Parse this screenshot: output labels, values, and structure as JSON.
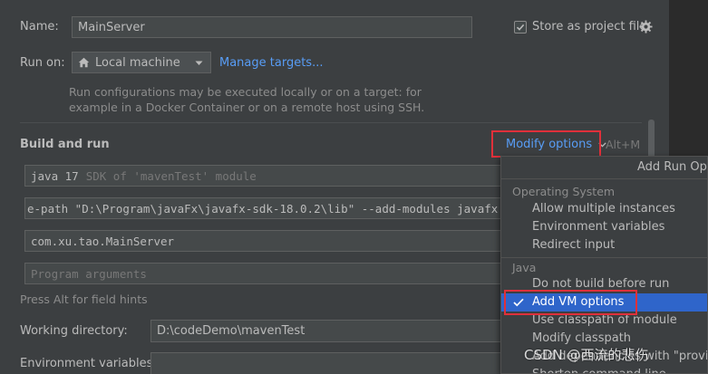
{
  "form": {
    "name_label": "Name:",
    "name_value": "MainServer",
    "store_label": "Store as project file",
    "run_on_label": "Run on:",
    "run_on_value": "Local machine",
    "manage_targets": "Manage targets...",
    "run_on_hint_1": "Run configurations may be executed locally or on a target: for",
    "run_on_hint_2": "example in a Docker Container or on a remote host using SSH.",
    "build_run_heading": "Build and run",
    "modify_options": "Modify options",
    "modify_shortcut": "Alt+M",
    "jdk_value": "java 17",
    "jdk_hint": "SDK of 'mavenTest' module",
    "vm_options_value": "e-path \"D:\\Program\\javaFx\\javafx-sdk-18.0.2\\lib\" --add-modules javafx.contr",
    "main_class_value": "com.xu.tao.MainServer",
    "program_args_placeholder": "Program arguments",
    "field_hints": "Press Alt for field hints",
    "working_dir_label": "Working directory:",
    "working_dir_value": "D:\\codeDemo\\mavenTest",
    "env_vars_label": "Environment variables:"
  },
  "popup": {
    "title": "Add Run Opti",
    "groups": [
      {
        "header": "Operating System",
        "items": [
          "Allow multiple instances",
          "Environment variables",
          "Redirect input"
        ]
      },
      {
        "header": "Java",
        "items": [
          "Do not build before run",
          "Add VM options",
          "Use classpath of module",
          "Modify classpath",
          "Add dependencies with \"provided\"",
          "Shorten command line"
        ]
      }
    ],
    "selected_item": "Add VM options"
  },
  "watermark": "CSDN @西流的悲伤",
  "colors": {
    "background": "#3c3f41",
    "accent_link": "#589df6",
    "selection": "#2f65ca",
    "highlight_box": "#e0303a"
  }
}
